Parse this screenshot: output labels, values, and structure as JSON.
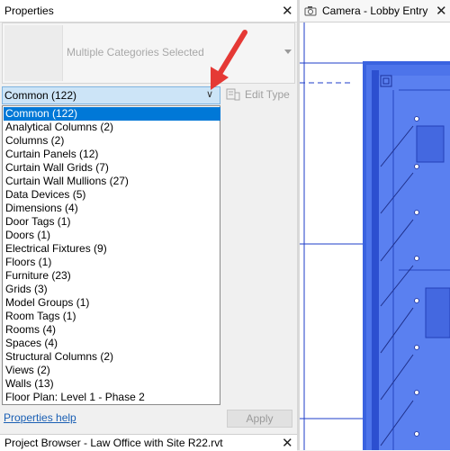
{
  "properties": {
    "title": "Properties",
    "close_glyph": "✕",
    "type_selector_label": "Multiple Categories Selected",
    "filter_value": "Common (122)",
    "edit_type_label": "Edit Type",
    "help_link": "Properties help",
    "apply_label": "Apply",
    "dropdown_items": [
      "Common (122)",
      "Analytical Columns (2)",
      "Columns (2)",
      "Curtain Panels (12)",
      "Curtain Wall Grids (7)",
      "Curtain Wall Mullions (27)",
      "Data Devices (5)",
      "Dimensions (4)",
      "Door Tags (1)",
      "Doors (1)",
      "Electrical Fixtures (9)",
      "Floors (1)",
      "Furniture (23)",
      "Grids (3)",
      "Model Groups (1)",
      "Room Tags (1)",
      "Rooms (4)",
      "Spaces (4)",
      "Structural Columns (2)",
      "Views (2)",
      "Walls (13)",
      "Floor Plan: Level 1 - Phase 2"
    ],
    "selected_index": 0
  },
  "project_browser": {
    "title": "Project Browser - Law Office with Site R22.rvt",
    "close_glyph": "✕"
  },
  "view": {
    "title": "Camera - Lobby Entry",
    "close_glyph": "✕"
  },
  "colors": {
    "selection_blue": "#0078d7",
    "model_blue": "#2f55d4",
    "annotation_arrow": "#e53935"
  }
}
